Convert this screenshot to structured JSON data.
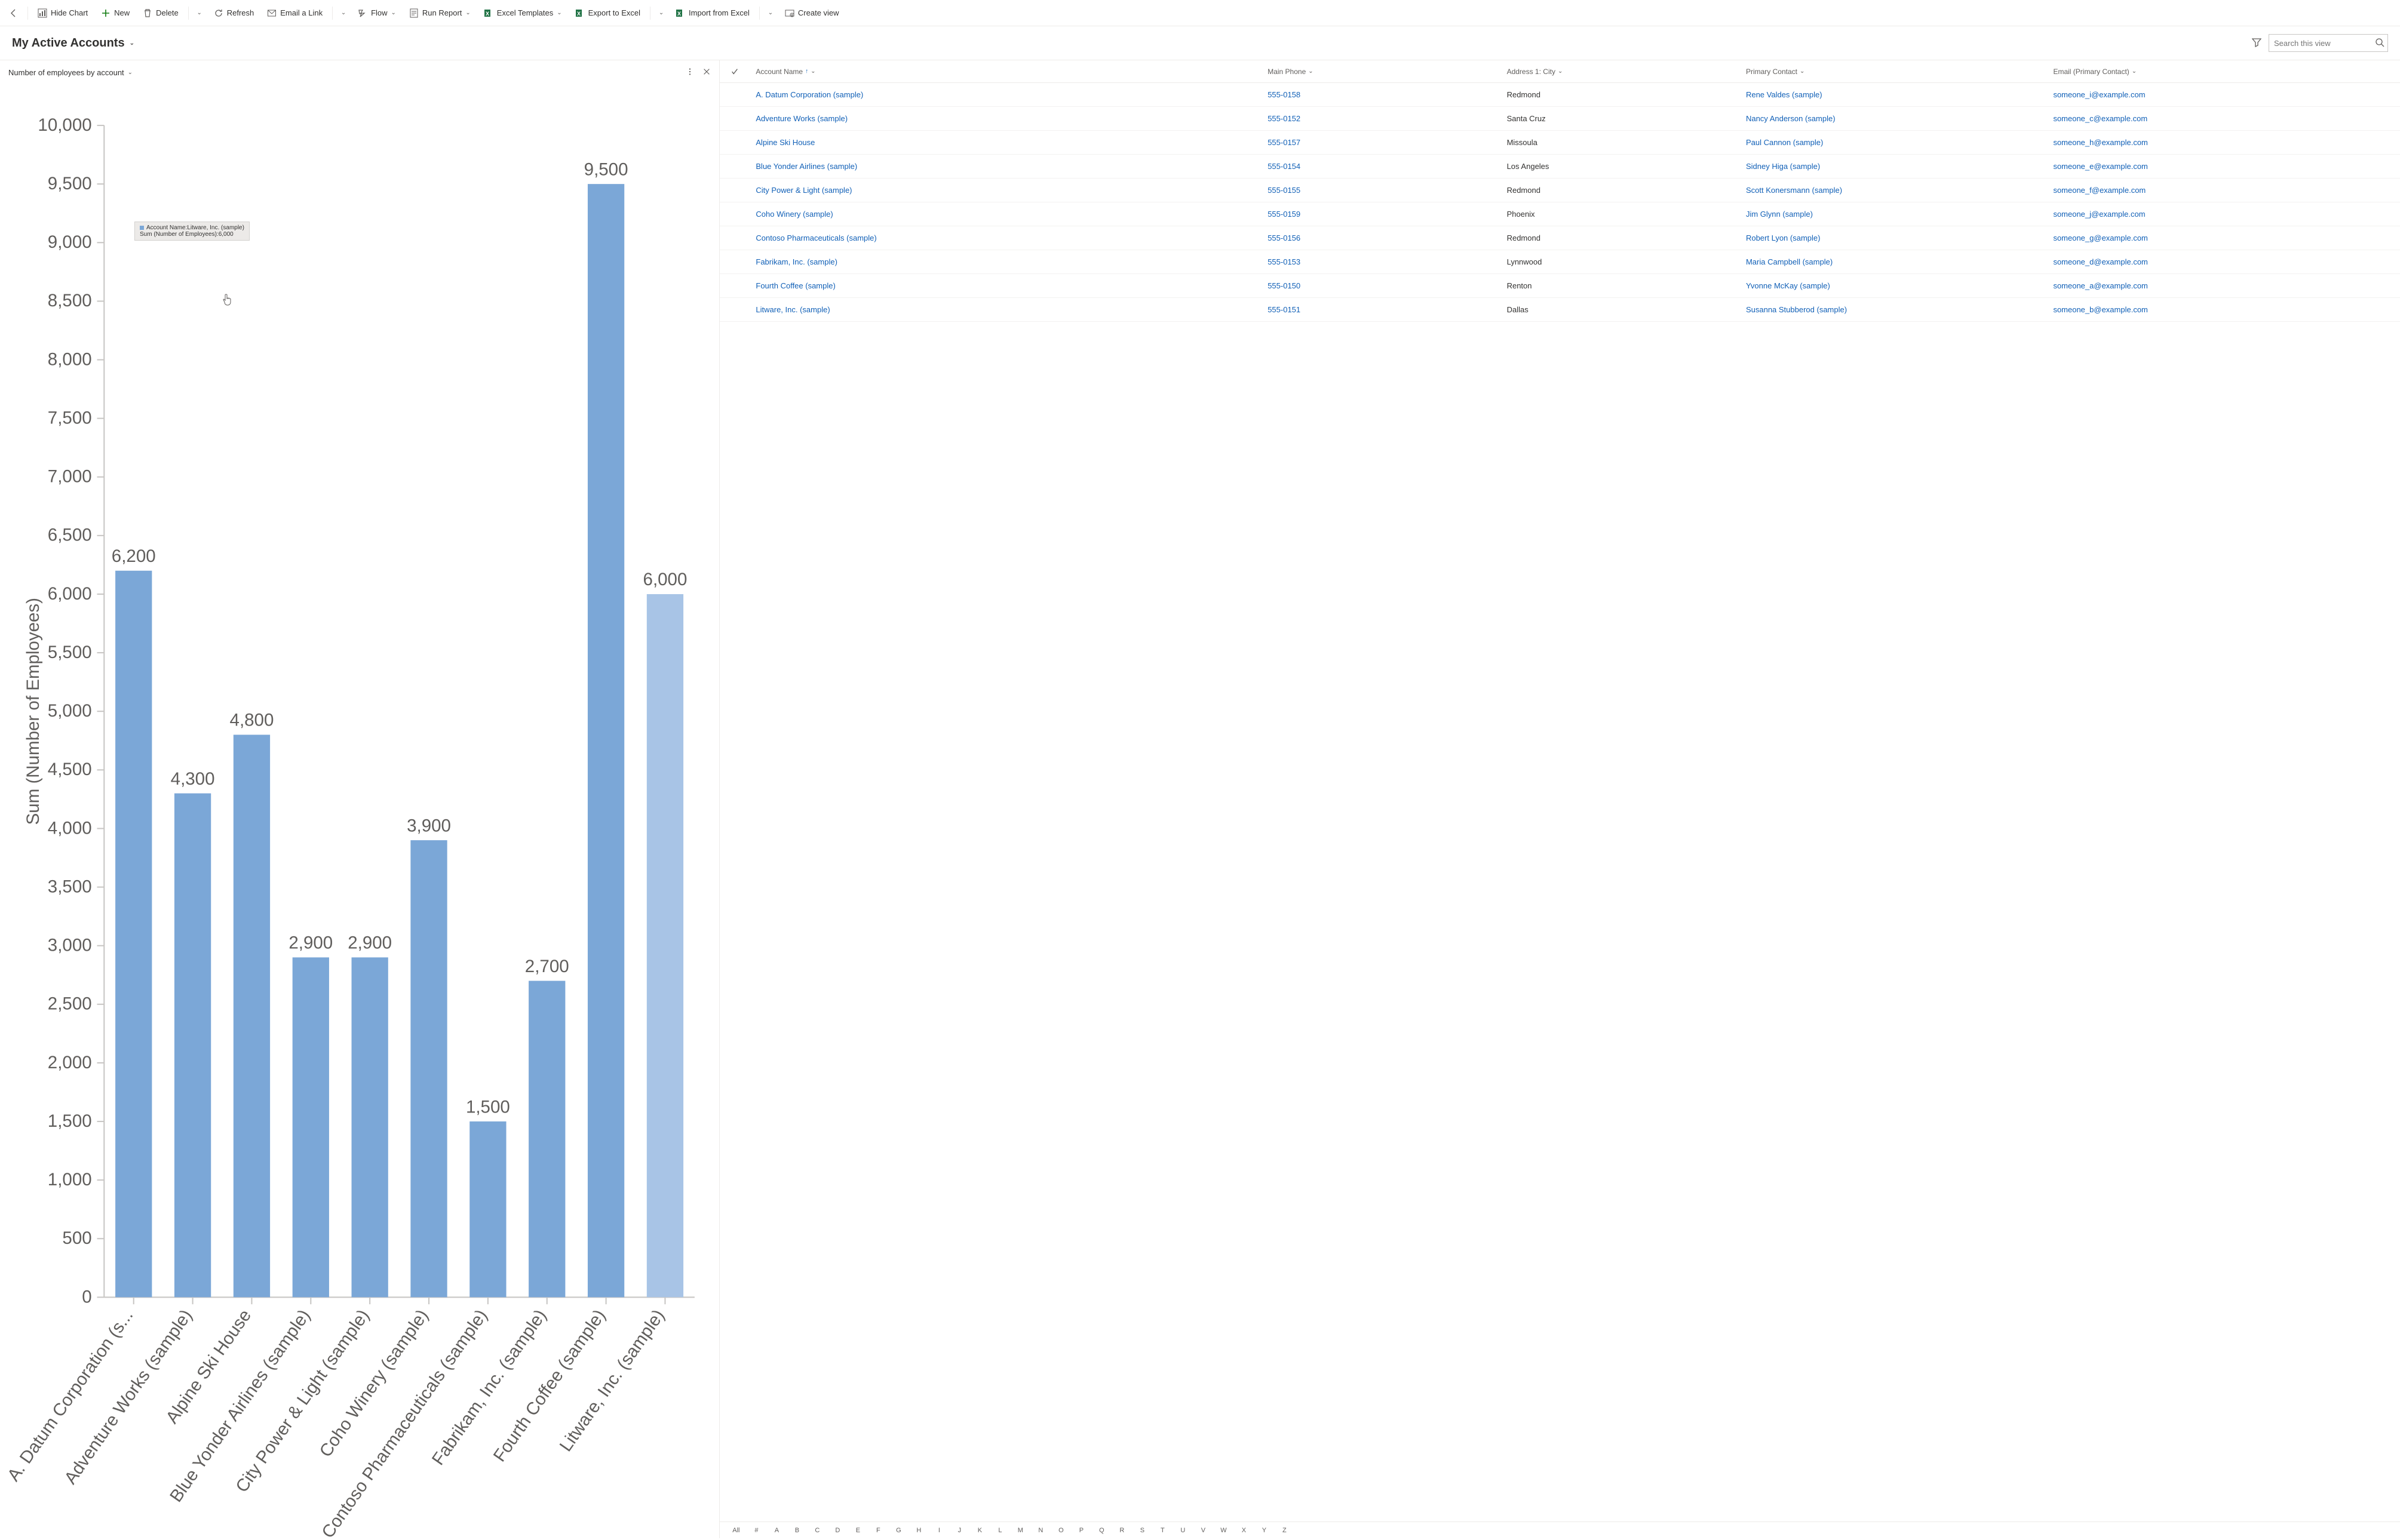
{
  "toolbar": {
    "hide_chart": "Hide Chart",
    "new": "New",
    "delete": "Delete",
    "refresh": "Refresh",
    "email_link": "Email a Link",
    "flow": "Flow",
    "run_report": "Run Report",
    "excel_templates": "Excel Templates",
    "export_excel": "Export to Excel",
    "import_excel": "Import from Excel",
    "create_view": "Create view"
  },
  "header": {
    "view_title": "My Active Accounts",
    "search_placeholder": "Search this view"
  },
  "chart": {
    "title": "Number of employees by account",
    "tooltip_line1": "Account Name:Litware, Inc. (sample)",
    "tooltip_line2": "Sum (Number of Employees):6,000"
  },
  "grid": {
    "columns": {
      "name": "Account Name",
      "phone": "Main Phone",
      "city": "Address 1: City",
      "contact": "Primary Contact",
      "email": "Email (Primary Contact)"
    },
    "rows": [
      {
        "name": "A. Datum Corporation (sample)",
        "phone": "555-0158",
        "city": "Redmond",
        "contact": "Rene Valdes (sample)",
        "email": "someone_i@example.com"
      },
      {
        "name": "Adventure Works (sample)",
        "phone": "555-0152",
        "city": "Santa Cruz",
        "contact": "Nancy Anderson (sample)",
        "email": "someone_c@example.com"
      },
      {
        "name": "Alpine Ski House",
        "phone": "555-0157",
        "city": "Missoula",
        "contact": "Paul Cannon (sample)",
        "email": "someone_h@example.com"
      },
      {
        "name": "Blue Yonder Airlines (sample)",
        "phone": "555-0154",
        "city": "Los Angeles",
        "contact": "Sidney Higa (sample)",
        "email": "someone_e@example.com"
      },
      {
        "name": "City Power & Light (sample)",
        "phone": "555-0155",
        "city": "Redmond",
        "contact": "Scott Konersmann (sample)",
        "email": "someone_f@example.com"
      },
      {
        "name": "Coho Winery (sample)",
        "phone": "555-0159",
        "city": "Phoenix",
        "contact": "Jim Glynn (sample)",
        "email": "someone_j@example.com"
      },
      {
        "name": "Contoso Pharmaceuticals (sample)",
        "phone": "555-0156",
        "city": "Redmond",
        "contact": "Robert Lyon (sample)",
        "email": "someone_g@example.com"
      },
      {
        "name": "Fabrikam, Inc. (sample)",
        "phone": "555-0153",
        "city": "Lynnwood",
        "contact": "Maria Campbell (sample)",
        "email": "someone_d@example.com"
      },
      {
        "name": "Fourth Coffee (sample)",
        "phone": "555-0150",
        "city": "Renton",
        "contact": "Yvonne McKay (sample)",
        "email": "someone_a@example.com"
      },
      {
        "name": "Litware, Inc. (sample)",
        "phone": "555-0151",
        "city": "Dallas",
        "contact": "Susanna Stubberod (sample)",
        "email": "someone_b@example.com"
      }
    ]
  },
  "alpha": [
    "All",
    "#",
    "A",
    "B",
    "C",
    "D",
    "E",
    "F",
    "G",
    "H",
    "I",
    "J",
    "K",
    "L",
    "M",
    "N",
    "O",
    "P",
    "Q",
    "R",
    "S",
    "T",
    "U",
    "V",
    "W",
    "X",
    "Y",
    "Z"
  ],
  "chart_data": {
    "type": "bar",
    "title": "Number of employees by account",
    "ylabel": "Sum (Number of Employees)",
    "xlabel": "",
    "ylim": [
      0,
      10000
    ],
    "yticks": [
      0,
      500,
      1000,
      1500,
      2000,
      2500,
      3000,
      3500,
      4000,
      4500,
      5000,
      5500,
      6000,
      6500,
      7000,
      7500,
      8000,
      8500,
      9000,
      9500,
      10000
    ],
    "categories": [
      "A. Datum Corporation (s...",
      "Adventure Works (sample)",
      "Alpine Ski House",
      "Blue Yonder Airlines (sample)",
      "City Power & Light (sample)",
      "Coho Winery (sample)",
      "Contoso Pharmaceuticals (sample)",
      "Fabrikam, Inc. (sample)",
      "Fourth Coffee (sample)",
      "Litware, Inc. (sample)"
    ],
    "values": [
      6200,
      4300,
      4800,
      2900,
      2900,
      3900,
      1500,
      2700,
      9500,
      6000
    ],
    "value_labels": [
      "6,200",
      "4,300",
      "4,800",
      "2,900",
      "2,900",
      "3,900",
      "1,500",
      "2,700",
      "9,500",
      "6,000"
    ],
    "highlight_index": 9
  }
}
